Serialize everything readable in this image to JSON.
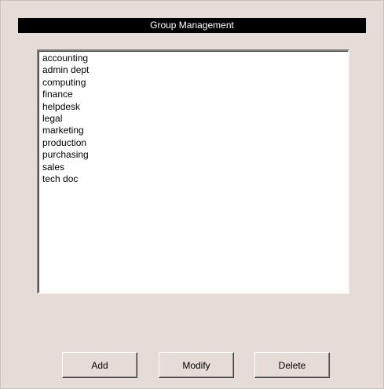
{
  "window": {
    "title": "Group Management"
  },
  "groups": [
    "accounting",
    "admin dept",
    "computing",
    "finance",
    "helpdesk",
    "legal",
    "marketing",
    "production",
    "purchasing",
    "sales",
    "tech doc"
  ],
  "buttons": {
    "add_label": "Add",
    "modify_label": "Modify",
    "delete_label": "Delete"
  },
  "colors": {
    "panel_background": "#e5dcd7",
    "title_bar_background": "#000000",
    "title_bar_text": "#ffffff",
    "list_background": "#ffffff"
  }
}
